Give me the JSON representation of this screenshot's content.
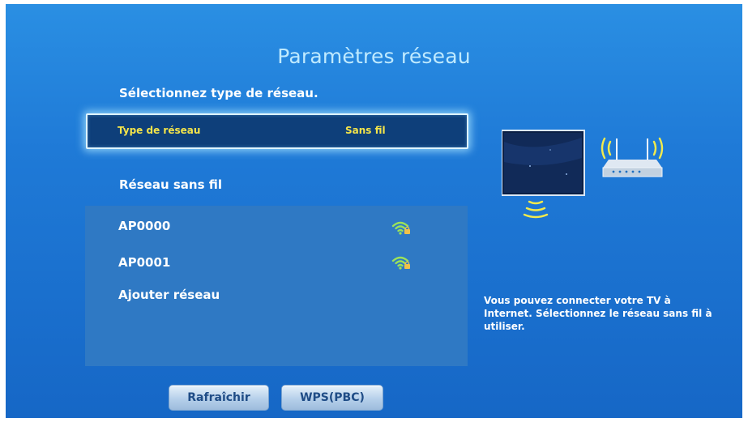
{
  "header": {
    "title": "Paramètres réseau"
  },
  "network_type": {
    "heading": "Sélectionnez type de réseau.",
    "label": "Type de réseau",
    "value": "Sans fil"
  },
  "wireless": {
    "heading": "Réseau sans fil",
    "items": [
      {
        "label": "AP0000",
        "icon": "wifi-locked-icon"
      },
      {
        "label": "AP0001",
        "icon": "wifi-locked-icon"
      },
      {
        "label": "Ajouter réseau"
      }
    ]
  },
  "buttons": {
    "refresh": "Rafraîchir",
    "wps": "WPS(PBC)"
  },
  "help": {
    "text": "Vous pouvez connecter votre TV à Internet. Sélectionnez le réseau sans fil à utiliser."
  },
  "colors": {
    "background": "#1f7ad7",
    "highlight_text": "#f4e44a",
    "title_text": "#bfeaff"
  }
}
